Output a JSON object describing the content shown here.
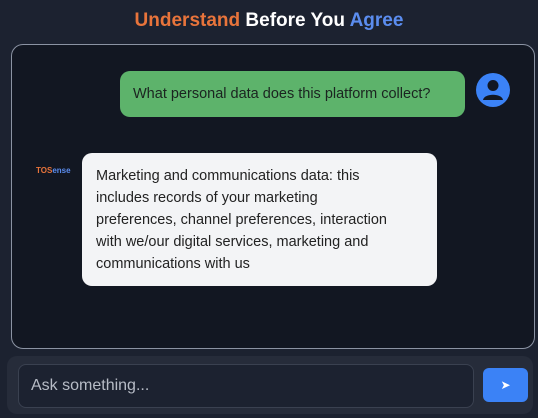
{
  "header": {
    "title_part1": "Understand",
    "title_part2": " Before You ",
    "title_part3": "Agree"
  },
  "colors": {
    "accent_orange": "#e8743b",
    "accent_blue": "#5b8def",
    "user_bubble": "#5db36b",
    "send_button": "#3b82f6"
  },
  "chat": {
    "messages": [
      {
        "role": "user",
        "text": "What personal data does this platform collect?",
        "icon": "user-avatar-icon"
      },
      {
        "role": "bot",
        "logo_part1": "TOS",
        "logo_part2": "ense",
        "lines": [
          "Marketing and communications data: this",
          "includes records of your marketing",
          "preferences, channel preferences, interaction",
          "with we/our digital services, marketing and",
          "communications with us"
        ]
      }
    ]
  },
  "composer": {
    "placeholder": "Ask something...",
    "send_glyph": "➤",
    "send_icon": "send-icon"
  }
}
